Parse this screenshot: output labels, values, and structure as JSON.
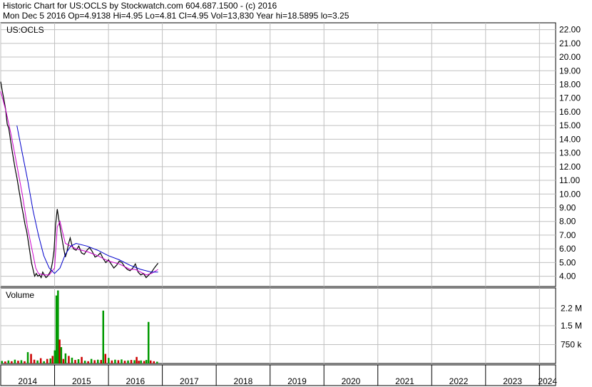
{
  "header": {
    "line1": "Historic Chart for US:OCLS by Stockwatch.com 604.687.1500 - (c) 2016",
    "line2": "Mon Dec  5 2016  Op=4.9138  Hi=4.95  Lo=4.81  Cl=4.95  Vol=13,830  Year hi=18.5895  lo=3.25"
  },
  "chart_data": {
    "type": "line",
    "symbol_label": "US:OCLS",
    "volume_label": "Volume",
    "x_ticks": [
      "2014",
      "2015",
      "2016",
      "2017",
      "2018",
      "2019",
      "2020",
      "2021",
      "2022",
      "2023",
      "2024"
    ],
    "y_ticks": [
      "22.00",
      "21.00",
      "20.00",
      "19.00",
      "18.00",
      "17.00",
      "16.00",
      "15.00",
      "14.00",
      "13.00",
      "12.00",
      "11.00",
      "10.00",
      "9.00",
      "8.00",
      "7.00",
      "6.00",
      "5.00",
      "4.00"
    ],
    "ylim": [
      3.25,
      22.5
    ],
    "volume_ticks": [
      "2.2 M",
      "1.5 M",
      "750 k"
    ],
    "volume_tick_values": [
      2200000,
      1500000,
      750000
    ],
    "volume_ylim": [
      0,
      3000000
    ],
    "xlim": [
      2014.0,
      2024.3
    ],
    "grid": true,
    "colors": {
      "price": "#000000",
      "ma_short": "#cc00cc",
      "ma_long": "#0000cc",
      "vol_up": "#009900",
      "vol_down": "#cc0000",
      "grid": "#c0c0c0"
    },
    "series": [
      {
        "key": "price",
        "x": [
          2014.0,
          2014.03,
          2014.06,
          2014.09,
          2014.12,
          2014.15,
          2014.18,
          2014.21,
          2014.24,
          2014.27,
          2014.3,
          2014.33,
          2014.36,
          2014.39,
          2014.42,
          2014.45,
          2014.48,
          2014.51,
          2014.54,
          2014.57,
          2014.6,
          2014.63,
          2014.66,
          2014.69,
          2014.72,
          2014.75,
          2014.78,
          2014.81,
          2014.84,
          2014.87,
          2014.9,
          2014.93,
          2014.96,
          2014.99,
          2015.02,
          2015.05,
          2015.08,
          2015.11,
          2015.14,
          2015.17,
          2015.2,
          2015.23,
          2015.26,
          2015.29,
          2015.32,
          2015.35,
          2015.4,
          2015.45,
          2015.5,
          2015.55,
          2015.6,
          2015.65,
          2015.7,
          2015.75,
          2015.8,
          2015.85,
          2015.9,
          2015.95,
          2016.0,
          2016.05,
          2016.1,
          2016.15,
          2016.2,
          2016.25,
          2016.3,
          2016.35,
          2016.4,
          2016.45,
          2016.5,
          2016.55,
          2016.6,
          2016.65,
          2016.7,
          2016.75,
          2016.8,
          2016.85,
          2016.92
        ],
        "y": [
          18.2,
          17.5,
          16.9,
          16.2,
          15.1,
          14.8,
          14.0,
          13.2,
          12.5,
          11.8,
          11.2,
          10.5,
          9.8,
          9.1,
          8.5,
          7.8,
          7.3,
          6.6,
          5.8,
          5.0,
          4.5,
          4.0,
          4.2,
          4.0,
          4.1,
          3.9,
          4.3,
          4.1,
          3.9,
          4.0,
          4.2,
          4.4,
          5.0,
          5.9,
          7.8,
          8.9,
          8.1,
          7.4,
          6.7,
          6.0,
          5.4,
          5.8,
          6.4,
          6.8,
          6.3,
          6.0,
          5.9,
          6.2,
          5.7,
          5.6,
          5.9,
          6.1,
          5.8,
          5.4,
          5.5,
          5.7,
          5.3,
          5.0,
          5.2,
          4.9,
          4.6,
          4.8,
          5.1,
          5.0,
          4.7,
          4.5,
          4.4,
          4.6,
          4.9,
          4.3,
          4.1,
          4.2,
          3.9,
          4.1,
          4.3,
          4.6,
          4.95
        ]
      },
      {
        "key": "ma_short",
        "x": [
          2014.0,
          2014.1,
          2014.2,
          2014.3,
          2014.4,
          2014.5,
          2014.6,
          2014.65,
          2014.7,
          2014.8,
          2014.9,
          2015.0,
          2015.05,
          2015.1,
          2015.2,
          2015.3,
          2015.4,
          2015.6,
          2015.8,
          2016.0,
          2016.2,
          2016.4,
          2016.5,
          2016.6,
          2016.7,
          2016.8,
          2016.92
        ],
        "y": [
          17.5,
          16.0,
          14.2,
          12.1,
          10.0,
          7.5,
          5.6,
          4.6,
          4.2,
          4.1,
          4.1,
          4.6,
          7.6,
          8.0,
          6.4,
          6.2,
          6.0,
          5.8,
          5.5,
          5.1,
          4.9,
          4.5,
          4.5,
          4.3,
          4.1,
          4.2,
          4.5
        ]
      },
      {
        "key": "ma_long",
        "x": [
          2014.3,
          2014.4,
          2014.5,
          2014.6,
          2014.7,
          2014.8,
          2014.9,
          2015.0,
          2015.1,
          2015.2,
          2015.3,
          2015.4,
          2015.6,
          2015.8,
          2016.0,
          2016.2,
          2016.4,
          2016.6,
          2016.8,
          2016.92
        ],
        "y": [
          15.0,
          13.0,
          11.0,
          8.8,
          7.0,
          5.5,
          4.6,
          4.2,
          4.6,
          5.6,
          6.2,
          6.4,
          6.2,
          5.9,
          5.5,
          5.2,
          4.8,
          4.5,
          4.3,
          4.3
        ]
      }
    ],
    "volume": {
      "x": [
        2014.02,
        2014.08,
        2014.14,
        2014.2,
        2014.26,
        2014.32,
        2014.38,
        2014.44,
        2014.5,
        2014.56,
        2014.62,
        2014.68,
        2014.74,
        2014.8,
        2014.86,
        2014.92,
        2014.96,
        2015.0,
        2015.03,
        2015.06,
        2015.09,
        2015.12,
        2015.16,
        2015.2,
        2015.26,
        2015.32,
        2015.38,
        2015.44,
        2015.5,
        2015.56,
        2015.62,
        2015.68,
        2015.74,
        2015.8,
        2015.86,
        2015.9,
        2015.94,
        2016.0,
        2016.06,
        2016.12,
        2016.18,
        2016.24,
        2016.3,
        2016.36,
        2016.42,
        2016.48,
        2016.52,
        2016.56,
        2016.6,
        2016.66,
        2016.7,
        2016.74,
        2016.78,
        2016.84,
        2016.9
      ],
      "v": [
        100000,
        80000,
        120000,
        90000,
        150000,
        110000,
        130000,
        90000,
        450000,
        380000,
        150000,
        120000,
        210000,
        90000,
        180000,
        200000,
        300000,
        520000,
        2700000,
        2900000,
        950000,
        650000,
        180000,
        400000,
        300000,
        230000,
        140000,
        170000,
        260000,
        110000,
        90000,
        180000,
        130000,
        150000,
        140000,
        2100000,
        380000,
        220000,
        120000,
        150000,
        130000,
        160000,
        110000,
        120000,
        140000,
        130000,
        260000,
        110000,
        120000,
        100000,
        140000,
        1650000,
        120000,
        90000,
        70000
      ],
      "up": [
        true,
        false,
        true,
        false,
        true,
        false,
        true,
        false,
        true,
        false,
        false,
        true,
        false,
        true,
        false,
        true,
        false,
        true,
        true,
        true,
        false,
        true,
        false,
        true,
        false,
        true,
        false,
        true,
        false,
        true,
        false,
        true,
        false,
        true,
        false,
        true,
        false,
        true,
        false,
        true,
        false,
        true,
        false,
        true,
        false,
        true,
        false,
        false,
        true,
        false,
        true,
        true,
        false,
        false,
        true
      ]
    }
  }
}
